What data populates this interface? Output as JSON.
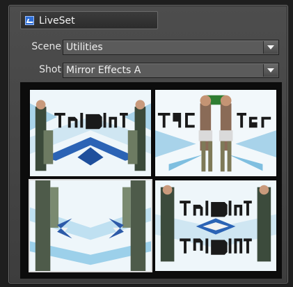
{
  "panel": {
    "title": "LiveSet",
    "title_icon": "liveset-icon"
  },
  "scene": {
    "label": "Scene",
    "value": "Utilities"
  },
  "shot": {
    "label": "Shot",
    "value": "Mirror Effects A"
  },
  "thumbnails": [
    {
      "name": "thumbnail-1",
      "selected": false
    },
    {
      "name": "thumbnail-2",
      "selected": false
    },
    {
      "name": "thumbnail-3",
      "selected": true
    },
    {
      "name": "thumbnail-4",
      "selected": false
    }
  ],
  "colors": {
    "panel_bg": "#444444",
    "accent": "#2f6fd6"
  }
}
